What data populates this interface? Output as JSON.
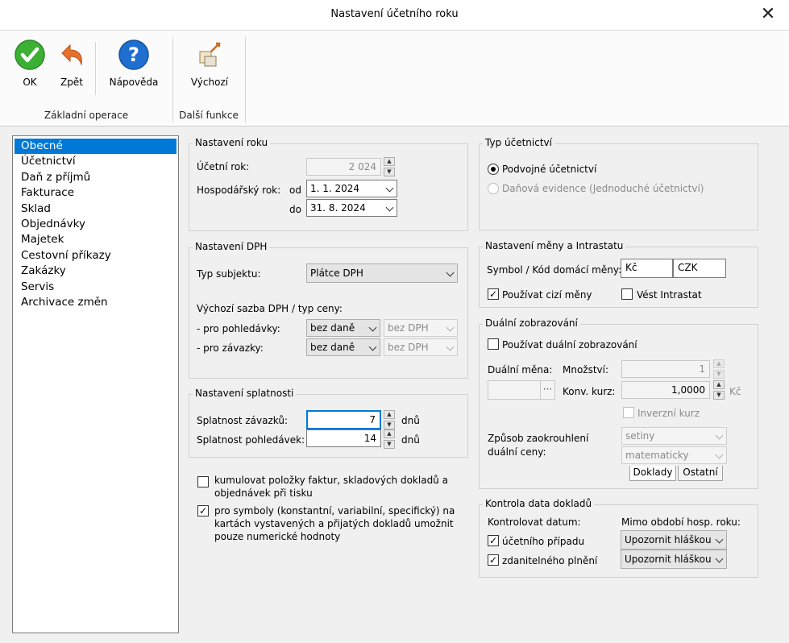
{
  "window": {
    "title": "Nastavení účetního roku"
  },
  "ribbon": {
    "ok": "OK",
    "back": "Zpět",
    "help": "Nápověda",
    "default": "Výchozí",
    "group_basic": "Základní operace",
    "group_other": "Další funkce"
  },
  "nav": {
    "items": [
      "Obecné",
      "Účetnictví",
      "Daň z příjmů",
      "Fakturace",
      "Sklad",
      "Objednávky",
      "Majetek",
      "Cestovní příkazy",
      "Zakázky",
      "Servis",
      "Archivace změn"
    ],
    "selected": "Obecné"
  },
  "year": {
    "title": "Nastavení roku",
    "fiscal_year_label": "Účetní rok:",
    "fiscal_year_value": "2 024",
    "business_year_label": "Hospodářský rok:",
    "from_label": "od",
    "from_value": "1.   1. 2024",
    "to_label": "do",
    "to_value": "31.   8. 2024"
  },
  "vat": {
    "title": "Nastavení DPH",
    "subject_type_label": "Typ subjektu:",
    "subject_type_value": "Plátce DPH",
    "default_rate_label": "Výchozí sazba DPH / typ ceny:",
    "receivables_label": "- pro pohledávky:",
    "receivables_rate": "bez daně",
    "receivables_type": "bez DPH",
    "payables_label": "- pro závazky:",
    "payables_rate": "bez daně",
    "payables_type": "bez DPH"
  },
  "due": {
    "title": "Nastavení splatnosti",
    "payables_label": "Splatnost závazků:",
    "payables_value": "7",
    "receivables_label": "Splatnost pohledávek:",
    "receivables_value": "14",
    "unit": "dnů"
  },
  "options": {
    "cumulate_label": "kumulovat položky faktur, skladových dokladů a objednávek při tisku",
    "cumulate_checked": false,
    "numeric_symbols_label": "pro symboly (konstantní, variabilní, specifický) na kartách vystavených a přijatých dokladů umožnit pouze numerické hodnoty",
    "numeric_symbols_checked": true
  },
  "accounting_type": {
    "title": "Typ účetnictví",
    "double_entry": "Podvojné účetnictví",
    "tax_records": "Daňová evidence (Jednoduché účetnictví)",
    "selected": "double_entry"
  },
  "currency": {
    "title": "Nastavení měny a Intrastatu",
    "symbol_label": "Symbol / Kód domácí měny:",
    "symbol_value": "Kč",
    "code_value": "CZK",
    "foreign_label": "Používat cizí měny",
    "foreign_checked": true,
    "intrastat_label": "Vést Intrastat",
    "intrastat_checked": false
  },
  "dual": {
    "title": "Duální zobrazování",
    "use_label": "Používat duální zobrazování",
    "use_checked": false,
    "currency_label": "Duální měna:",
    "currency_value": "",
    "browse_label": "···",
    "quantity_label": "Množství:",
    "quantity_value": "1",
    "rate_label": "Konv. kurz:",
    "rate_value": "1,0000",
    "rate_unit": "Kč",
    "inverse_label": "Inverzní kurz",
    "inverse_checked": false,
    "rounding_label": "Způsob zaokrouhlení duální ceny:",
    "rounding_value": "setiny",
    "rounding_method": "matematicky",
    "tab_documents": "Doklady",
    "tab_other": "Ostatní"
  },
  "date_control": {
    "title": "Kontrola data dokladů",
    "check_label": "Kontrolovat datum:",
    "out_of_period_label": "Mimo období hosp. roku:",
    "accounting_case_label": "účetního případu",
    "accounting_case_checked": true,
    "accounting_case_action": "Upozornit hláškou",
    "taxable_label": "zdanitelného plnění",
    "taxable_checked": true,
    "taxable_action": "Upozornit hláškou"
  },
  "colors": {
    "accent": "#0078d7",
    "ok_green": "#3cb034",
    "help_blue": "#1f6fd0",
    "back_orange": "#e8702a"
  }
}
